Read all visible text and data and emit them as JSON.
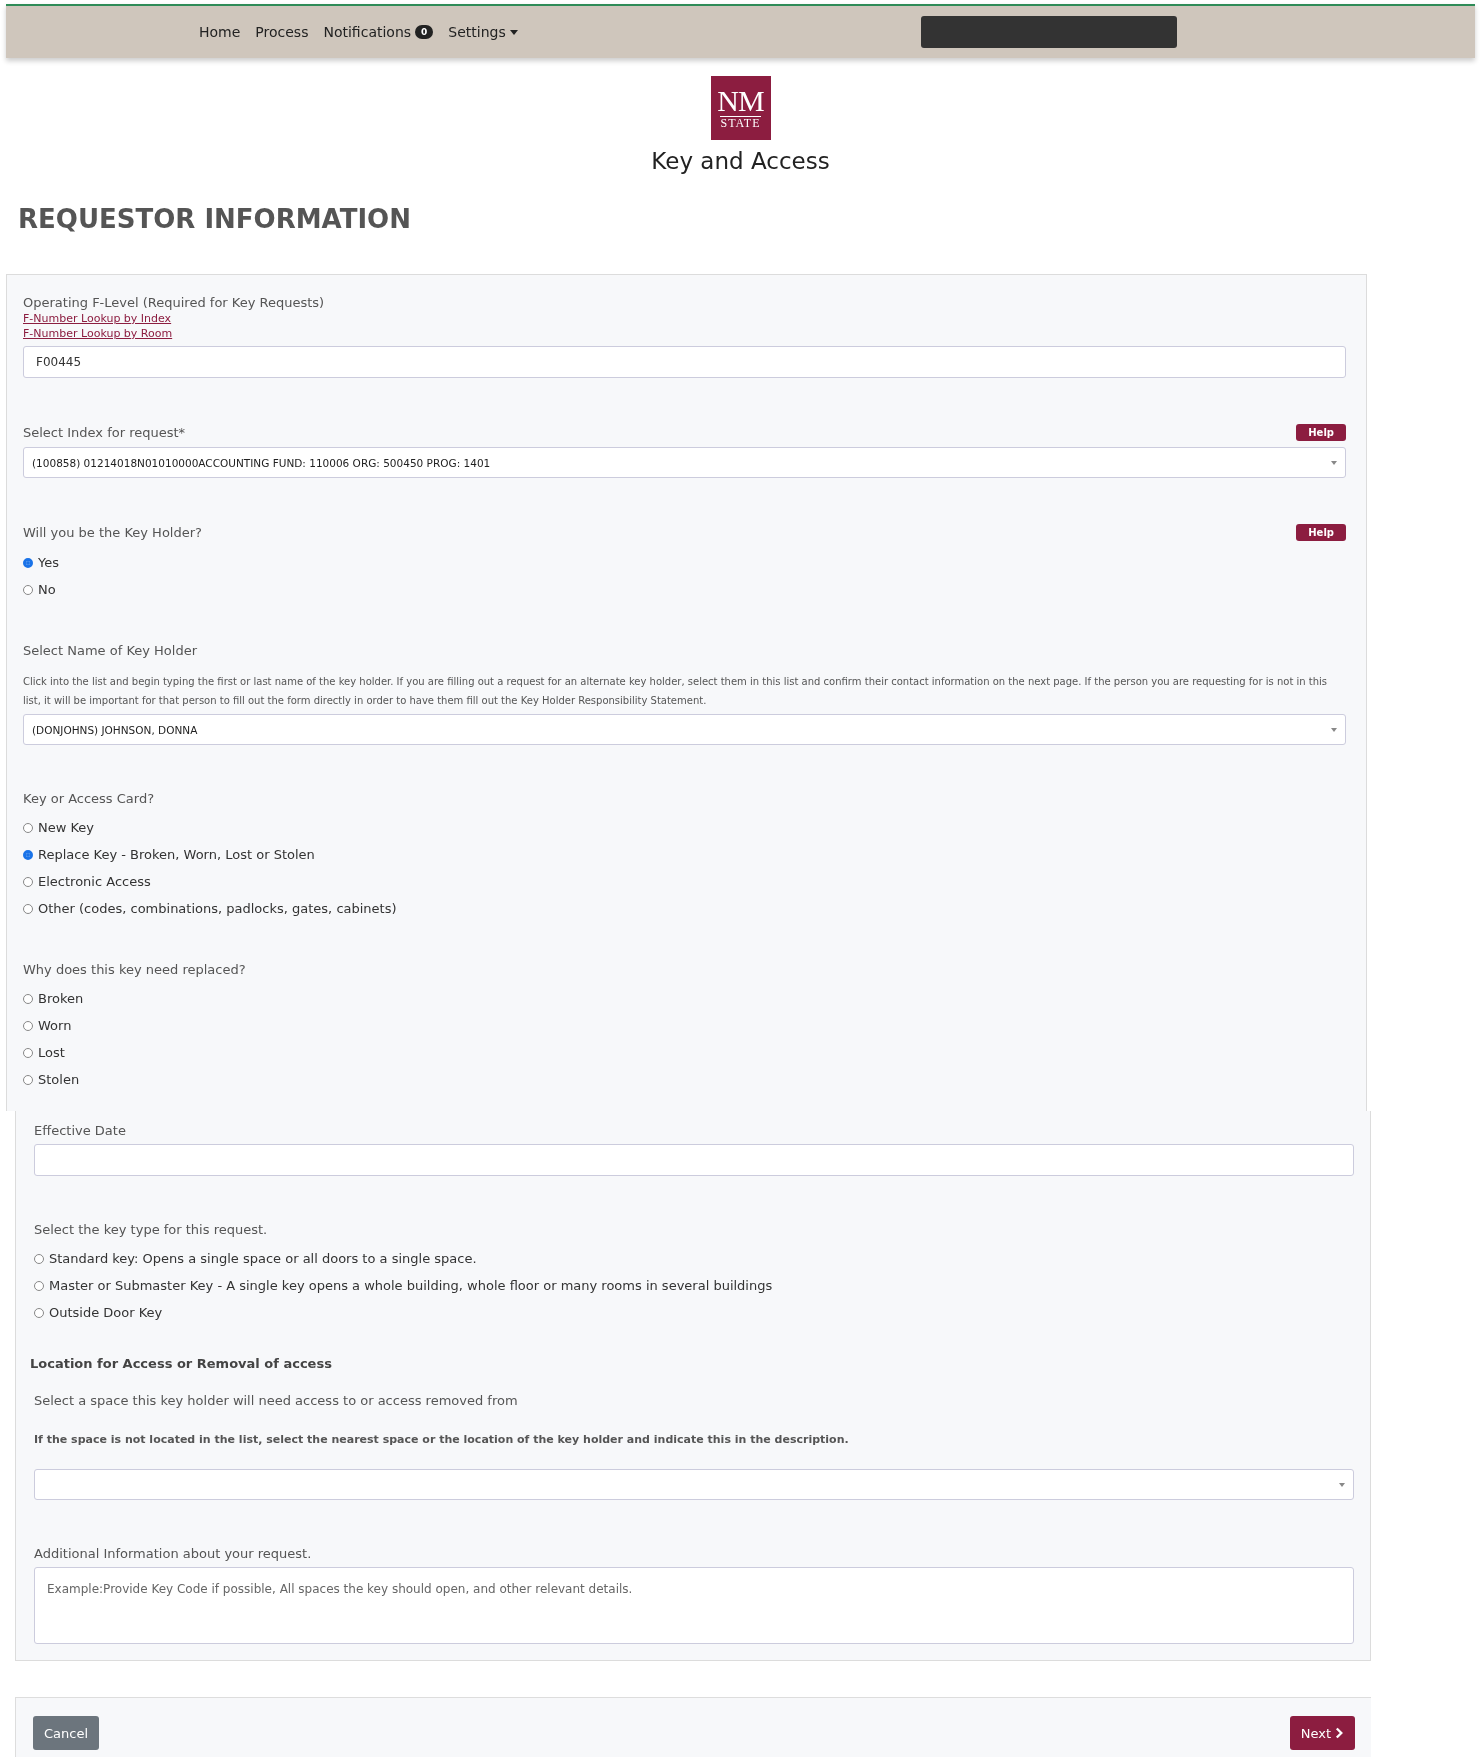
{
  "nav": {
    "items": [
      {
        "label": "Home",
        "kind": "link"
      },
      {
        "label": "Process",
        "kind": "link"
      },
      {
        "label": "Notifications",
        "kind": "badge",
        "badge": "0"
      },
      {
        "label": "Settings",
        "kind": "dropdown"
      }
    ]
  },
  "logo": {
    "line_1": "NM",
    "line_2": "STATE"
  },
  "app_title": "Key and Access",
  "page_heading": "REQUESTOR INFORMATION",
  "panels": [
    {
      "fields": [
        {
          "kind": "text",
          "label": "Operating F-Level (Required for Key Requests)",
          "links": [
            "F-Number Lookup by Index",
            "F-Number Lookup by Room"
          ],
          "value": "F00445"
        },
        {
          "kind": "select",
          "label": "Select Index for request*",
          "help": "Help",
          "value": "(100858) 01214018N01010000ACCOUNTING FUND: 110006 ORG: 500450 PROG: 1401"
        },
        {
          "kind": "radio",
          "label": "Will you be the Key Holder?",
          "help": "Help",
          "options": [
            {
              "label": "Yes",
              "selected": true
            },
            {
              "label": "No",
              "selected": false
            }
          ]
        },
        {
          "kind": "select",
          "label": "Select Name of Key Holder",
          "note": {
            "text": "Click into the list and begin typing the first or last name of the key holder.  If you are filling out a request for an alternate key holder, select them in this list and confirm their contact information on the next page. If the person you are requesting for is not in this list, it will be important for that person to fill out the form directly in order to have them fill out the Key Holder Responsibility Statement.",
            "bold": false
          },
          "value": "(DONJOHNS) JOHNSON, DONNA"
        },
        {
          "kind": "radio",
          "label": "Key or Access Card?",
          "options": [
            {
              "label": "New Key",
              "selected": false
            },
            {
              "label": "Replace Key - Broken, Worn, Lost or Stolen",
              "selected": true
            },
            {
              "label": "Electronic Access",
              "selected": false
            },
            {
              "label": "Other (codes, combinations, padlocks, gates, cabinets)",
              "selected": false
            }
          ]
        },
        {
          "kind": "radio",
          "label": "Why does this key need replaced?",
          "options": [
            {
              "label": "Broken",
              "selected": false
            },
            {
              "label": "Worn",
              "selected": false
            },
            {
              "label": "Lost",
              "selected": false
            },
            {
              "label": "Stolen",
              "selected": false
            }
          ]
        }
      ]
    },
    {
      "fields": [
        {
          "kind": "text",
          "label": "Effective Date"
        },
        {
          "kind": "radio",
          "label": "Select the key type for this request.",
          "options": [
            {
              "label": "Standard key: Opens a single space or all doors to a single space.",
              "selected": false
            },
            {
              "label": "Master or Submaster Key - A single key opens a whole building, whole floor or many rooms in several buildings",
              "selected": false
            },
            {
              "label": "Outside Door Key",
              "selected": false
            }
          ]
        },
        {
          "kind": "heading",
          "text": "Location for Access or Removal of access"
        },
        {
          "kind": "select",
          "label": "Select a space this key holder will need access to or access removed from",
          "note": {
            "text": "If the space is not located in the list, select the nearest space or the location of the key holder and indicate this in the description.",
            "bold": true
          }
        },
        {
          "kind": "textarea",
          "label": "Additional Information about your request.",
          "placeholder": "Example:Provide Key Code if possible, All spaces the key should open, and other relevant details."
        }
      ]
    }
  ],
  "footer": {
    "buttons": [
      {
        "label": "Cancel",
        "kind": "secondary"
      },
      {
        "label": "Next",
        "kind": "primary"
      }
    ]
  }
}
